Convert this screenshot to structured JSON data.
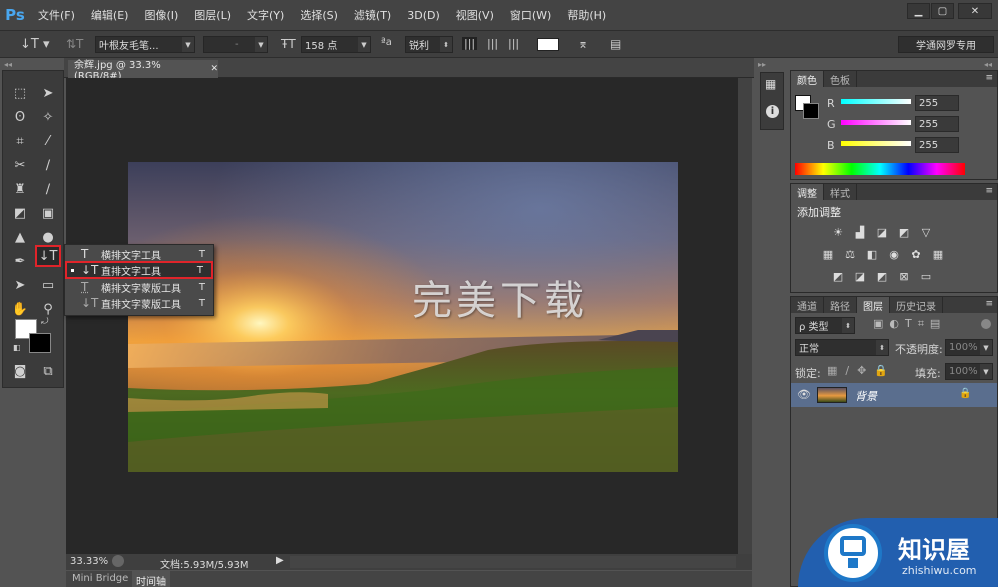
{
  "app": {
    "logo": "Ps"
  },
  "menu": [
    "文件(F)",
    "编辑(E)",
    "图像(I)",
    "图层(L)",
    "文字(Y)",
    "选择(S)",
    "滤镜(T)",
    "3D(D)",
    "视图(V)",
    "窗口(W)",
    "帮助(H)"
  ],
  "options": {
    "font_family": "叶根友毛笔...",
    "font_style": "-",
    "font_size": "158 点",
    "aa_label": "ªa",
    "aa_mode": "锐利",
    "workspace": "学通网罗专用"
  },
  "document": {
    "tab_title": "余辉.jpg @ 33.3%(RGB/8#)",
    "overlay_text": "完美下载",
    "zoom": "33.33%",
    "doc_info": "文档:5.93M/5.93M"
  },
  "flyout": [
    {
      "label": "横排文字工具",
      "shortcut": "T",
      "icon": "T"
    },
    {
      "label": "直排文字工具",
      "shortcut": "T",
      "icon": "↓T"
    },
    {
      "label": "横排文字蒙版工具",
      "shortcut": "T",
      "icon": "T"
    },
    {
      "label": "直排文字蒙版工具",
      "shortcut": "T",
      "icon": "↓T"
    }
  ],
  "bottom_tabs": [
    "Mini Bridge",
    "时间轴"
  ],
  "color_panel": {
    "tabs": [
      "颜色",
      "色板"
    ],
    "channels": [
      {
        "name": "R",
        "value": "255",
        "color": "#00ffff"
      },
      {
        "name": "G",
        "value": "255",
        "color": "#ff00ff"
      },
      {
        "name": "B",
        "value": "255",
        "color": "#ffff00"
      }
    ]
  },
  "adjust_panel": {
    "tabs": [
      "调整",
      "样式"
    ],
    "title": "添加调整"
  },
  "layers_panel": {
    "tabs": [
      "通道",
      "路径",
      "图层",
      "历史记录"
    ],
    "filter": "ρ 类型",
    "blend_mode": "正常",
    "opacity_label": "不透明度:",
    "opacity_value": "100%",
    "lock_label": "锁定:",
    "fill_label": "填充:",
    "fill_value": "100%",
    "layer_name": "背景"
  },
  "watermark": {
    "name": "知识屋",
    "url": "zhishiwu.com"
  },
  "colors": {
    "accent_red": "#e0242a",
    "ps_blue": "#49a7f0",
    "selected_layer": "#5a6e8e"
  }
}
